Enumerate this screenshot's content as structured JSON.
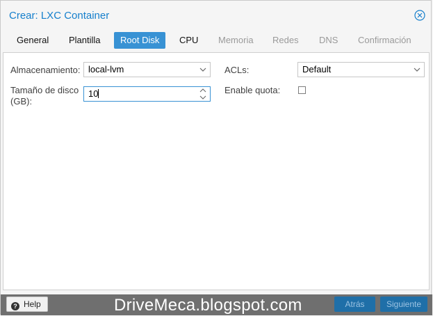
{
  "dialog": {
    "title": "Crear: LXC Container",
    "close_icon": "close-circle-icon"
  },
  "tabs": [
    {
      "label": "General",
      "state": "normal"
    },
    {
      "label": "Plantilla",
      "state": "normal"
    },
    {
      "label": "Root Disk",
      "state": "active"
    },
    {
      "label": "CPU",
      "state": "normal"
    },
    {
      "label": "Memoria",
      "state": "disabled"
    },
    {
      "label": "Redes",
      "state": "disabled"
    },
    {
      "label": "DNS",
      "state": "disabled"
    },
    {
      "label": "Confirmación",
      "state": "disabled"
    }
  ],
  "form": {
    "storage_label": "Almacenamiento:",
    "storage_value": "local-lvm",
    "disk_size_label_line1": "Tamaño de disco",
    "disk_size_label_line2": "(GB):",
    "disk_size_value": "10",
    "acls_label": "ACLs:",
    "acls_value": "Default",
    "quota_label": "Enable quota:",
    "quota_checked": false
  },
  "footer": {
    "help_label": "Help",
    "watermark": "DriveMeca.blogspot.com",
    "back_label": "Atrás",
    "next_label": "Siguiente"
  },
  "colors": {
    "accent": "#3892d4",
    "title": "#157fcc",
    "footer_bg": "#6f6f6f",
    "primary_btn": "#1f6fa8"
  }
}
